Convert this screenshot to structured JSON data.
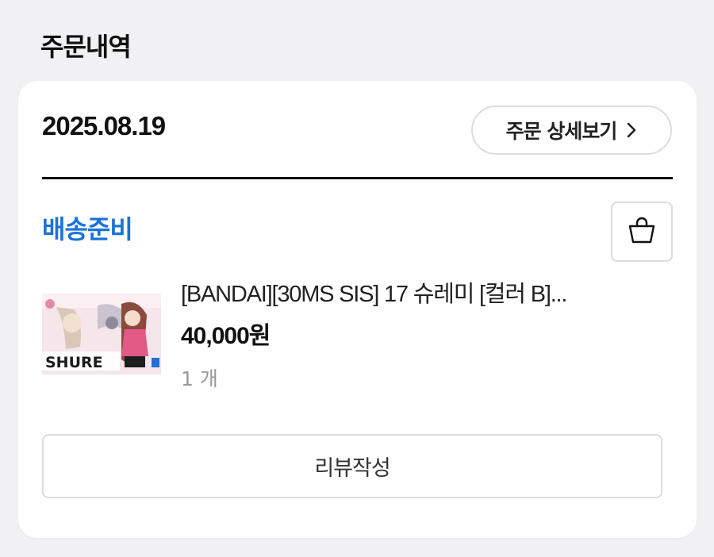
{
  "page": {
    "title": "주문내역"
  },
  "order": {
    "date": "2025.08.19",
    "detail_button_label": "주문 상세보기",
    "status": "배송준비",
    "status_color": "#1a73d9",
    "item": {
      "name": "[BANDAI][30MS SIS] 17 슈레미 [컬러 B]...",
      "price": "40,000원",
      "quantity": "1 개",
      "thumbnail_text": "SHURE"
    },
    "review_button_label": "리뷰작성"
  },
  "icons": {
    "chevron": "chevron-right-icon",
    "bag": "shopping-bag-icon"
  }
}
